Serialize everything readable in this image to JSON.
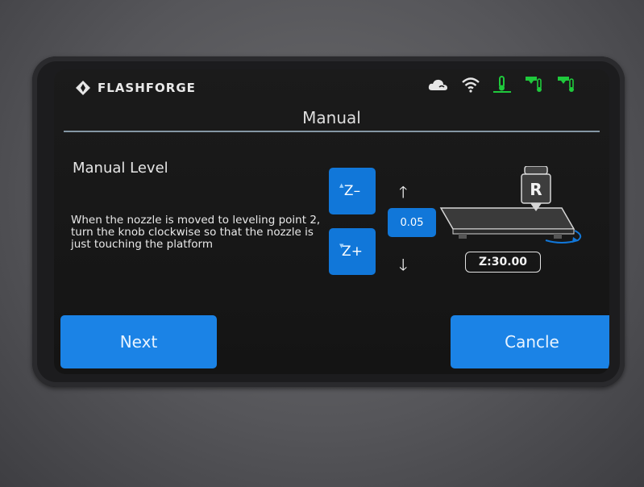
{
  "header": {
    "brand": "FLASHFORGE",
    "status_icons": [
      "cloud-icon",
      "wifi-icon",
      "bed-temp-icon",
      "nozzle1-temp-icon",
      "nozzle2-temp-icon"
    ],
    "status_color": "#1fc93c"
  },
  "page": {
    "title": "Manual",
    "heading": "Manual Level",
    "instruction": "When the nozzle is moved to leveling point 2, turn the knob clockwise so that the nozzle is just touching the platform"
  },
  "controls": {
    "z_minus_label": "Z–",
    "z_plus_label": "Z+",
    "step_value": "0.05",
    "z_readout": "Z:30.00",
    "nozzle_label": "R"
  },
  "buttons": {
    "next": "Next",
    "cancel": "Cancle"
  },
  "colors": {
    "accent": "#1177d9",
    "screen_bg": "#161616"
  }
}
